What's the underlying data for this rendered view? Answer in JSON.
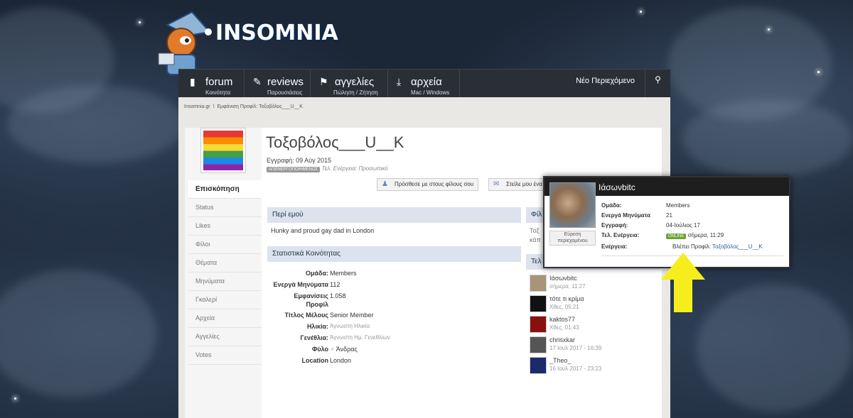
{
  "colors": {
    "nav_bg": "#2a2f36",
    "panel_head": "#dce3ee",
    "online_badge": "#6aa532",
    "arrow": "#f5ee1c"
  },
  "logo": {
    "text": "INSOMNIA",
    "icon": "mascot-logo"
  },
  "nav": {
    "items": [
      {
        "title": "forum",
        "sub": "Κοινότητα",
        "icon": "chat-icon"
      },
      {
        "title": "reviews",
        "sub": "Παρουσιάσεις",
        "icon": "edit-icon"
      },
      {
        "title": "αγγελίες",
        "sub": "Πώληση / Ζήτηση",
        "icon": "tag-icon"
      },
      {
        "title": "αρχεία",
        "sub": "Mac / Windows",
        "icon": "download-icon"
      }
    ],
    "new_content": "Νέο Περιεχόμενο",
    "pin_icon": "pin-icon"
  },
  "breadcrumb": {
    "home": "Insomnia.gr",
    "sep": "\\",
    "current": "Εμφάνιση Προφίλ: Τοξοβόλος___U__K"
  },
  "sidebar": {
    "items": [
      "Επισκόπηση",
      "Status",
      "Likes",
      "Φίλοι",
      "Θέματα",
      "Μηνύματα",
      "Γκαλερί",
      "Αρχεία",
      "Αγγελίες",
      "Votes"
    ]
  },
  "profile": {
    "username": "Τοξοβόλος___U__K",
    "joined": "Εγγραφή: 09 Αύγ 2015",
    "badge": "ΑΠΕΝΕΡΓΟΠΟΙΗΜΕΝΟΣ",
    "last_activity": "Τελ. Ενέργεια: Προσωπικό",
    "add_friend": "Πρόσθεσε με στους φίλους σου",
    "send_message": "Στείλε μου ένα"
  },
  "about": {
    "heading": "Περί εμού",
    "text": "Hunky and proud gay dad in London"
  },
  "stats": {
    "heading": "Στατιστικά Κοινότητας",
    "rows": [
      {
        "k": "Ομάδα:",
        "v": "Members"
      },
      {
        "k": "Ενεργά Μηνύματα",
        "v": "112"
      },
      {
        "k": "Εμφανίσεις",
        "v": "1.058"
      },
      {
        "k": "Προφίλ",
        "v": ""
      },
      {
        "k": "Τίτλος Μέλους",
        "v": "Senior Member"
      },
      {
        "k": "Ηλικία:",
        "v": "Άγνωστη Ηλικία"
      },
      {
        "k": "Γενέθλια:",
        "v": "Άγνωστη Ημ. Γενεθλίων"
      },
      {
        "k": "Φύλο",
        "v": "Άνδρας"
      },
      {
        "k": "Location",
        "v": "London"
      }
    ]
  },
  "right": {
    "friends_heading": "Φίλ",
    "friends_text1": "Τοξ",
    "friends_text2": "κάπ",
    "visitors_heading": "Τελ",
    "visitors": [
      {
        "name": "Ιάσωνbitc",
        "time": "σήμερα, 11:27"
      },
      {
        "name": "τότε τι κρίμα",
        "time": "Χθες, 05:21"
      },
      {
        "name": "kaktos77",
        "time": "Χθες, 01:43"
      },
      {
        "name": "chrisxkar",
        "time": "17 Ιουλ 2017 - 16:39"
      },
      {
        "name": "_Theo_",
        "time": "16 Ιουλ 2017 - 23:23"
      }
    ]
  },
  "popup": {
    "name": "Ιάσωνbitc",
    "find_content_1": "Εύρεση",
    "find_content_2": "περιεχομένου",
    "group_k": "Ομάδα:",
    "group_v": "Members",
    "posts_k": "Ενεργά Μηνύματα",
    "posts_v": "21",
    "joined_k": "Εγγραφή:",
    "joined_v": "04-Ιούλιος 17",
    "last_k": "Τελ. Ενέργεια:",
    "online": "ONLINE",
    "last_v": "σήμερα, 11:29",
    "activity_k": "Ενέργεια:",
    "activity_v": "Βλέπει Προφίλ:",
    "activity_link": "Τοξοβόλος___U__K"
  }
}
